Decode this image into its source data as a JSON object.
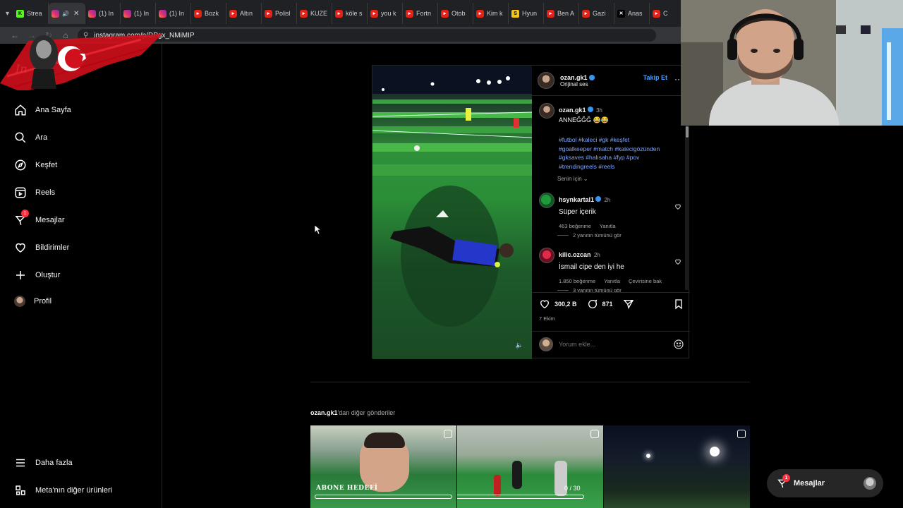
{
  "browser": {
    "tabs": [
      {
        "icon": "kick",
        "label": "Strea"
      },
      {
        "icon": "ig",
        "label": "",
        "active": true
      },
      {
        "icon": "ig",
        "label": "(1) In"
      },
      {
        "icon": "ig",
        "label": "(1) In"
      },
      {
        "icon": "ig",
        "label": "(1) In"
      },
      {
        "icon": "yt",
        "label": "Bozk"
      },
      {
        "icon": "yt",
        "label": "Altın"
      },
      {
        "icon": "yt",
        "label": "Polisl"
      },
      {
        "icon": "yt",
        "label": "KUZE"
      },
      {
        "icon": "yt",
        "label": "köle s"
      },
      {
        "icon": "yt",
        "label": "you k"
      },
      {
        "icon": "yt",
        "label": "Fortn"
      },
      {
        "icon": "yt",
        "label": "Otob"
      },
      {
        "icon": "yt",
        "label": "Kim k"
      },
      {
        "icon": "s",
        "label": "Hyun"
      },
      {
        "icon": "yt",
        "label": "Ben A"
      },
      {
        "icon": "yt",
        "label": "Gazi"
      },
      {
        "icon": "x",
        "label": "Anas"
      },
      {
        "icon": "yt",
        "label": "C"
      }
    ],
    "url": "instagram.com/p/DPgx_NMiMIP"
  },
  "sidebar": {
    "logo": "In",
    "items": [
      {
        "label": "Ana Sayfa",
        "icon": "home-icon"
      },
      {
        "label": "Ara",
        "icon": "search-icon"
      },
      {
        "label": "Keşfet",
        "icon": "compass-icon"
      },
      {
        "label": "Reels",
        "icon": "reels-icon"
      },
      {
        "label": "Mesajlar",
        "icon": "messenger-icon",
        "badge": "1"
      },
      {
        "label": "Bildirimler",
        "icon": "heart-icon"
      },
      {
        "label": "Oluştur",
        "icon": "plus-icon"
      },
      {
        "label": "Profil",
        "icon": "profile-avatar"
      }
    ],
    "bottom": [
      {
        "label": "Daha fazla",
        "icon": "menu-icon"
      },
      {
        "label": "Meta'nın diğer ürünleri",
        "icon": "meta-apps-icon"
      }
    ]
  },
  "post": {
    "username": "ozan.gk1",
    "audio": "Orijinal ses",
    "follow_label": "Takip Et",
    "caption_user": "ozan.gk1",
    "caption_time": "3h",
    "caption_text": "ANNEĞĞĞ 😂😂",
    "hashtags_line1": "#futbol #kaleci #gk #keşfet",
    "hashtags_line2": "#goalkeeper #match #kalecigözünden",
    "hashtags_line3": "#gksaves #halısaha #fyp #pov",
    "hashtags_line4": "#trendingreels #reels",
    "filter_label": "Senin için",
    "comments": [
      {
        "user": "hsynkartal1",
        "time": "2h",
        "text": "Süper içerik",
        "likes": "463 beğenme",
        "reply": "Yanıtla",
        "replies": "2 yanıtın tümünü gör"
      },
      {
        "user": "kilic.ozcan",
        "time": "2h",
        "text": "İsmail cipe den iyi he",
        "likes": "1.850 beğenme",
        "reply": "Yanıtla",
        "translate": "Çevirisine bak",
        "replies": "3 yanıtın tümünü gör"
      }
    ],
    "like_count": "300,2 B",
    "comment_count": "871",
    "date": "7 Ekim",
    "comment_placeholder": "Yorum ekle..."
  },
  "more": {
    "user": "ozan.gk1",
    "suffix": "'dan diğer gönderiler",
    "thumb1_text": "ABONE HEDEFİ",
    "thumb1_count": "0 / 30"
  },
  "messages_pill": {
    "label": "Mesajlar",
    "badge": "1"
  }
}
